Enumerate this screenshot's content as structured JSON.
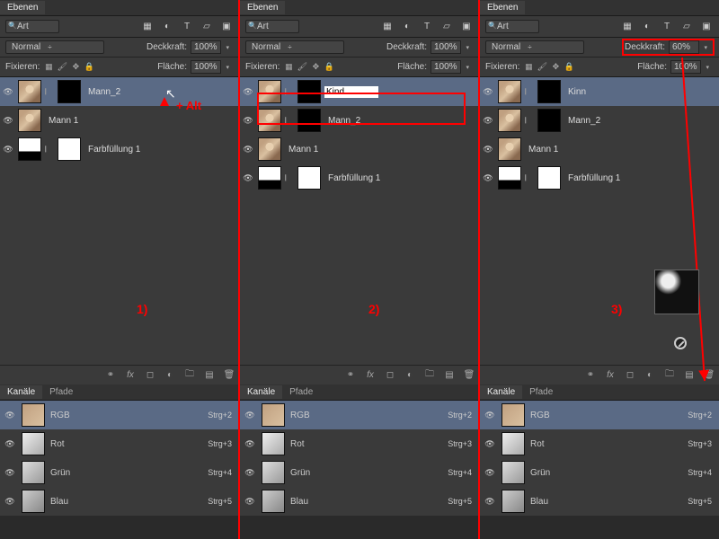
{
  "panel_title": "Ebenen",
  "filter_label": "Art",
  "blend_mode": "Normal",
  "opacity_label": "Deckkraft:",
  "fill_label": "Fläche:",
  "lock_label": "Fixieren:",
  "channels_tab": "Kanäle",
  "paths_tab": "Pfade",
  "annotations": {
    "step1": "1)",
    "step2": "2)",
    "step3": "3)",
    "alt_hint": "+ Alt"
  },
  "opacity_values": {
    "c1": "100%",
    "c2": "100%",
    "c3": "60%"
  },
  "fill_values": {
    "c1": "100%",
    "c2": "100%",
    "c3": "100%"
  },
  "rename_value": "Kind",
  "col1_layers": {
    "l0": {
      "name": "Mann_2"
    },
    "l1": {
      "name": "Mann 1"
    },
    "l2": {
      "name": "Farbfüllung 1"
    }
  },
  "col2_layers": {
    "l0": {
      "name": ""
    },
    "l1": {
      "name": "Mann_2"
    },
    "l2": {
      "name": "Mann 1"
    },
    "l3": {
      "name": "Farbfüllung 1"
    }
  },
  "col3_layers": {
    "l0": {
      "name": "Kinn"
    },
    "l1": {
      "name": "Mann_2"
    },
    "l2": {
      "name": "Mann 1"
    },
    "l3": {
      "name": "Farbfüllung 1"
    }
  },
  "channels": {
    "rgb": {
      "name": "RGB",
      "shortcut": "Strg+2"
    },
    "r": {
      "name": "Rot",
      "shortcut": "Strg+3"
    },
    "g": {
      "name": "Grün",
      "shortcut": "Strg+4"
    },
    "b": {
      "name": "Blau",
      "shortcut": "Strg+5"
    }
  }
}
